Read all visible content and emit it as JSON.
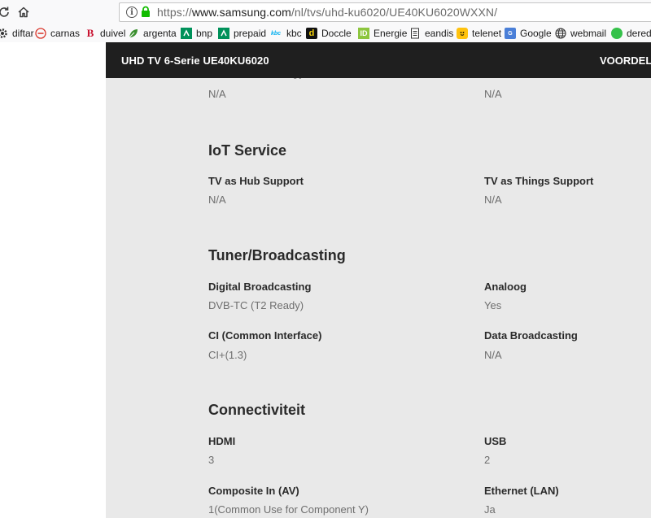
{
  "browser": {
    "url_scheme": "https://",
    "url_domain": "www.samsung.com",
    "url_path": "/nl/tvs/uhd-ku6020/UE40KU6020WXXN/"
  },
  "bookmarks": [
    {
      "label": "diftar",
      "icon": "gear-icon"
    },
    {
      "label": "carnas",
      "icon": "minus-circle-icon"
    },
    {
      "label": "duivel",
      "icon": "b-logo-icon"
    },
    {
      "label": "argenta",
      "icon": "leaf-icon"
    },
    {
      "label": "bnp",
      "icon": "bnp-logo-icon"
    },
    {
      "label": "prepaid",
      "icon": "bnp-logo-icon"
    },
    {
      "label": "kbc",
      "icon": "kbc-logo-icon"
    },
    {
      "label": "Doccle",
      "icon": "doccle-logo-icon"
    },
    {
      "label": "Energie",
      "icon": "id-logo-icon"
    },
    {
      "label": "eandis",
      "icon": "document-icon"
    },
    {
      "label": "telenet",
      "icon": "telenet-logo-icon"
    },
    {
      "label": "Google",
      "icon": "google-icon"
    },
    {
      "label": "webmail",
      "icon": "globe-icon"
    },
    {
      "label": "dereda",
      "icon": "green-circle-icon"
    }
  ],
  "header": {
    "title": "UHD TV 6-Serie UE40KU6020",
    "link": "VOORDELEN"
  },
  "top_row": {
    "left_value": "N/A",
    "right_value": "N/A"
  },
  "sections": {
    "iot": {
      "title": "IoT Service",
      "specs": [
        {
          "label": "TV as Hub Support",
          "value": "N/A"
        },
        {
          "label": "TV as Things Support",
          "value": "N/A"
        }
      ]
    },
    "tuner": {
      "title": "Tuner/Broadcasting",
      "specs": [
        {
          "label": "Digital Broadcasting",
          "value": "DVB-TC (T2 Ready)"
        },
        {
          "label": "Analoog",
          "value": "Yes"
        },
        {
          "label": "CI (Common Interface)",
          "value": "CI+(1.3)"
        },
        {
          "label": "Data Broadcasting",
          "value": "N/A"
        }
      ]
    },
    "connectivity": {
      "title": "Connectiviteit",
      "specs": [
        {
          "label": "HDMI",
          "value": "3"
        },
        {
          "label": "USB",
          "value": "2"
        },
        {
          "label": "Composite In (AV)",
          "value": "1(Common Use for Component Y)"
        },
        {
          "label": "Ethernet (LAN)",
          "value": "Ja"
        }
      ]
    }
  },
  "colors": {
    "header_bg": "#1f1f1f",
    "content_bg": "#e9e9e9",
    "lock_green": "#12bc00"
  }
}
